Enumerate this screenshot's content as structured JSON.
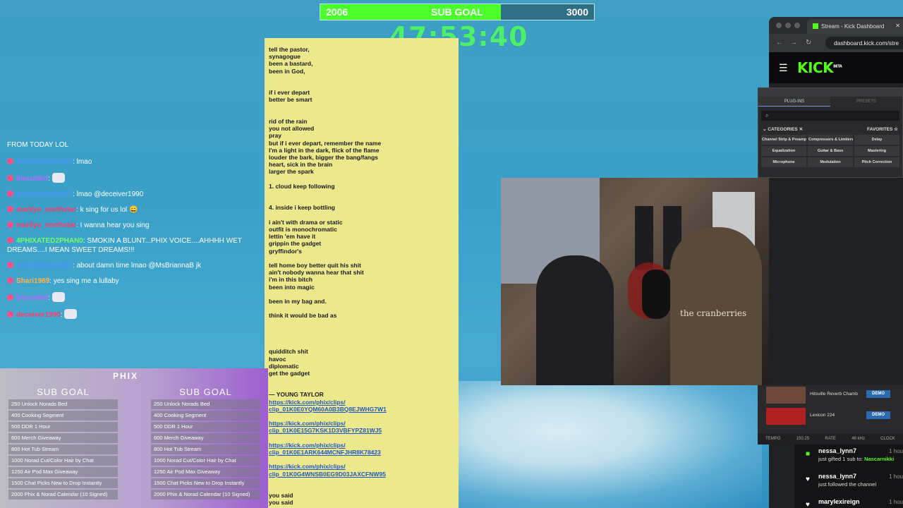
{
  "sub_goal": {
    "start": "2006",
    "title": "SUB GOAL",
    "target": "3000",
    "progress_fraction": 0.66
  },
  "timer": "47:53:40",
  "chat": {
    "header": "FROM TODAY LOL",
    "messages": [
      {
        "user": "ancientkesos617",
        "user_color": "#4a90ff",
        "text": ": lmao",
        "emote": false
      },
      {
        "user": "ilmcutdof",
        "user_color": "#b46bff",
        "text": ": ",
        "emote": true
      },
      {
        "user": "ancientkesos617",
        "user_color": "#4a90ff",
        "text": ": lmao @deceiver1990",
        "emote": false
      },
      {
        "user": "marilyn_northstar",
        "user_color": "#ff3b6b",
        "text": ": k sing for us lol 😄",
        "emote": false
      },
      {
        "user": "marilyn_northstar",
        "user_color": "#ff3b6b",
        "text": ": I wanna hear you sing",
        "emote": false
      },
      {
        "user": "4PHIXATED2PHAN0",
        "user_color": "#6dff6d",
        "text": ": SMOKIN A BLUNT...PHIX VOICE....AHHHH WET DREAMS....I MEAN SWEET DREAMS!!!",
        "emote": false
      },
      {
        "user": "ancientkesos617",
        "user_color": "#4a90ff",
        "text": ": about damn time lmao @MsBriannaB jk",
        "emote": false
      },
      {
        "user": "Shari1989",
        "user_color": "#ffb347",
        "text": ": yes sing me a lullaby",
        "emote": false
      },
      {
        "user": "ilmcutdof",
        "user_color": "#b46bff",
        "text": ": ",
        "emote": true
      },
      {
        "user": "deceiver1990",
        "user_color": "#ff3b6b",
        "text": ": ",
        "emote": true
      }
    ]
  },
  "lyrics": [
    "tell the pastor,",
    "synagogue",
    "been a bastard,",
    "been in God,",
    "",
    "",
    "if i ever depart",
    "better be smart",
    "",
    "",
    "rid of the rain",
    "you not allowed",
    "pray",
    "but if i ever depart, remember the name",
    "I'm a light in the dark, flick of the flame",
    "louder the bark, bigger the bang/fangs",
    "heart, sick in the brain",
    "larger the spark",
    "",
    "1. cloud keep following",
    "",
    "",
    "4. inside i keep bottling",
    "",
    "i ain't with drama or static",
    "outfit is monochromatic",
    "lettin 'em have it",
    "grippin the gadget",
    "gryffindor's",
    "",
    "tell home boy better quit his shit",
    "ain't nobody wanna hear that shit",
    "i'm in this bitch",
    "been into magic",
    "",
    "been in my bag and.",
    "",
    "think it would be bad as",
    "",
    "",
    "",
    "",
    "quidditch shit",
    "havoc",
    "diplomatic",
    "get the gadget",
    "",
    "",
    "— YOUNG TAYLOR"
  ],
  "lyric_links": [
    {
      "line1": "https://kick.com/phix/clips/",
      "line2": "clip_01K0E0YQM60A0B3BQ8EJWHG7W1"
    },
    {
      "line1": "https://kick.com/phix/clips/",
      "line2": "clip_01K0E15G7KSK1D3VBFYPZ81WJ5"
    },
    {
      "line1": "https://kick.com/phix/clips/",
      "line2": "clip_01K0E1ARK644MCNFJHR8K78423"
    },
    {
      "line1": "https://kick.com/phix/clips/",
      "line2": "clip_01K0G4WNSB0EG9D03JAXCFNW95"
    }
  ],
  "lyrics_tail": [
    "you said",
    "you said"
  ],
  "sub_goal_panel": {
    "logo": "PHIX",
    "heading": "SUB GOAL",
    "items": [
      "250 Unlock Norads Bed",
      "400 Cooking Segment",
      "500 DDR 1 Hour",
      "600 Merch Giveaway",
      "800 Hot Tub Stream",
      "1000 Norad Cut/Color Hair by Chat",
      "1250 Air Pod Max Giveaway",
      "1500 Chat Picks New to Drop Instantly",
      "2000 Phix & Norad Calendar (10 Signed)"
    ]
  },
  "webcam": {
    "shirt_text": "the cranberries"
  },
  "browser": {
    "tab_title": "Stream - Kick Dashboard",
    "url": "dashboard.kick.com/stre",
    "logo": "KICK",
    "logo_sup": "BETA"
  },
  "plugins": {
    "tabs": [
      "PLUG-INS",
      "PRESETS"
    ],
    "categories_label": "CATEGORIES",
    "favorites_label": "FAVORITES",
    "grid": [
      "Channel Strip & Preamp",
      "Compressors & Limiters",
      "Delay",
      "Equalization",
      "Guitar & Bass",
      "Mastering",
      "Microphone",
      "Modulation",
      "Pitch Correction"
    ],
    "presets": [
      {
        "name": "Hitsville Reverb Chamb",
        "button": "DEMO"
      },
      {
        "name": "Lexicon 224",
        "button": "DEMO"
      }
    ],
    "footer": [
      "TEMPO",
      "150.25",
      "RATE",
      "48 kHz",
      "CLOCK"
    ]
  },
  "activity": [
    {
      "user": "nessa_lynn7",
      "time": "1 hou",
      "desc_prefix": "just gifted 1 sub to: ",
      "desc_highlight": "Nascarnikki",
      "icon": "gift-icon"
    },
    {
      "user": "nessa_lynn7",
      "time": "1 hou",
      "desc_prefix": "just followed the channel",
      "desc_highlight": "",
      "icon": "heart-icon"
    },
    {
      "user": "marylexireign",
      "time": "1 hou",
      "desc_prefix": "",
      "desc_highlight": "",
      "icon": "heart-icon"
    }
  ]
}
